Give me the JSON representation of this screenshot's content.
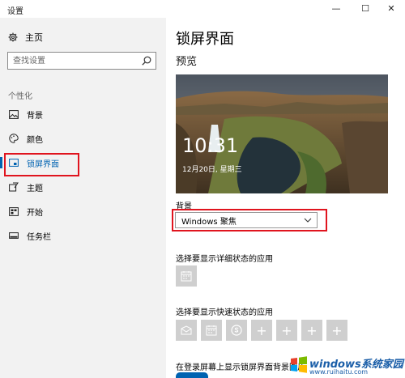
{
  "window": {
    "title": "设置",
    "controls": [
      "—",
      "☐",
      "✕"
    ]
  },
  "sidebar": {
    "home": "主页",
    "search_placeholder": "查找设置",
    "section": "个性化",
    "items": [
      {
        "label": "背景",
        "icon": "image-icon"
      },
      {
        "label": "颜色",
        "icon": "palette-icon"
      },
      {
        "label": "锁屏界面",
        "icon": "lock-screen-icon",
        "active": true
      },
      {
        "label": "主题",
        "icon": "theme-icon"
      },
      {
        "label": "开始",
        "icon": "start-icon"
      },
      {
        "label": "任务栏",
        "icon": "taskbar-icon"
      }
    ]
  },
  "main": {
    "title": "锁屏界面",
    "preview_heading": "预览",
    "preview": {
      "time": "10:31",
      "date": "12月20日, 星期三"
    },
    "background_label": "背景",
    "background_value": "Windows 聚焦",
    "detailed_status_label": "选择要显示详细状态的应用",
    "quick_status_label": "选择要显示快速状态的应用",
    "signin_label": "在登录屏幕上显示锁屏界面背景图片",
    "tile_plus": "+"
  },
  "watermark": {
    "brand": "windows系统家园",
    "url": "www.ruihaitu.com"
  },
  "colors": {
    "accent": "#0063b1",
    "highlight": "#e0141e",
    "sidebar_bg": "#f2f2f2"
  }
}
